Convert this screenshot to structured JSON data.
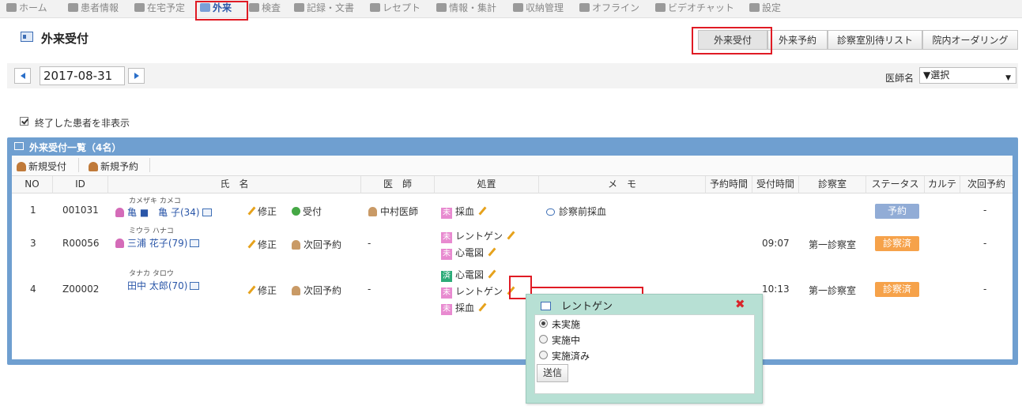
{
  "nav": {
    "items": [
      {
        "label": "ホーム",
        "icon": "home-icon"
      },
      {
        "label": "患者情報",
        "icon": "patient-icon"
      },
      {
        "label": "在宅予定",
        "icon": "clock-icon"
      },
      {
        "label": "外来",
        "icon": "outpatient-icon",
        "active": true
      },
      {
        "label": "検査",
        "icon": "exam-icon"
      },
      {
        "label": "記録・文書",
        "icon": "document-icon"
      },
      {
        "label": "レセプト",
        "icon": "receipt-icon"
      },
      {
        "label": "情報・集計",
        "icon": "report-icon"
      },
      {
        "label": "収納管理",
        "icon": "tag-icon"
      },
      {
        "label": "オフライン",
        "icon": "plug-icon"
      },
      {
        "label": "ビデオチャット",
        "icon": "video-icon"
      },
      {
        "label": "設定",
        "icon": "gear-icon"
      }
    ]
  },
  "header": {
    "title": "外来受付",
    "tabs": [
      "外来受付",
      "外来予約",
      "診察室別待リスト",
      "院内オーダリング"
    ]
  },
  "datebar": {
    "date": "2017-08-31",
    "doctor_label": "医師名",
    "doctor_selected": "▼選択"
  },
  "filter": {
    "hide_finished_label": "終了した患者を非表示",
    "checked": true
  },
  "panel": {
    "title": "外来受付一覧（4名）",
    "toolbar": {
      "new_reception": "新規受付",
      "new_reservation": "新規予約"
    },
    "columns": [
      "NO",
      "ID",
      "氏　名",
      "医　師",
      "処置",
      "メ　モ",
      "予約時間",
      "受付時間",
      "診察室",
      "ステータス",
      "カルテ",
      "次回予約"
    ],
    "rows": [
      {
        "no": "1",
        "id": "001031",
        "kana": "カメザキ カメコ",
        "name": "亀 ■　亀 子(34)",
        "edit": "修正",
        "action": "受付",
        "doctor": "中村医師",
        "procedures": [
          {
            "badge": "未",
            "label": "採血"
          }
        ],
        "memo": "診察前採血",
        "reserve_time": "",
        "reception_time": "",
        "room": "",
        "status": "予約",
        "next": "-"
      },
      {
        "no": "3",
        "id": "R00056",
        "kana": "ミウラ ハナコ",
        "name": "三浦 花子(79)",
        "edit": "修正",
        "action": "次回予約",
        "doctor": "-",
        "procedures": [
          {
            "badge": "未",
            "label": "レントゲン"
          },
          {
            "badge": "未",
            "label": "心電図"
          }
        ],
        "memo": "",
        "reserve_time": "",
        "reception_time": "09:07",
        "room": "第一診察室",
        "status": "診察済",
        "next": "-"
      },
      {
        "no": "4",
        "id": "Z00002",
        "kana": "タナカ タロウ",
        "name": "田中 太郎(70)",
        "edit": "修正",
        "action": "次回予約",
        "doctor": "-",
        "procedures": [
          {
            "badge": "済",
            "label": "心電図"
          },
          {
            "badge": "未",
            "label": "レントゲン"
          },
          {
            "badge": "未",
            "label": "採血"
          }
        ],
        "memo": "",
        "reserve_time": "",
        "reception_time": "10:13",
        "room": "第一診察室",
        "status": "診察済",
        "next": "-"
      }
    ]
  },
  "popup": {
    "title": "レントゲン",
    "options": [
      "未実施",
      "実施中",
      "実施済み"
    ],
    "selected": "未実施",
    "submit": "送信"
  },
  "colors": {
    "highlight": "#e01b24",
    "panel": "#6f9fd0",
    "status_reserved": "#91acd6",
    "status_done": "#f6a24a",
    "badge_pending": "#e88ad0",
    "badge_done": "#2cab78",
    "popup_bg": "#b7e0d4"
  }
}
